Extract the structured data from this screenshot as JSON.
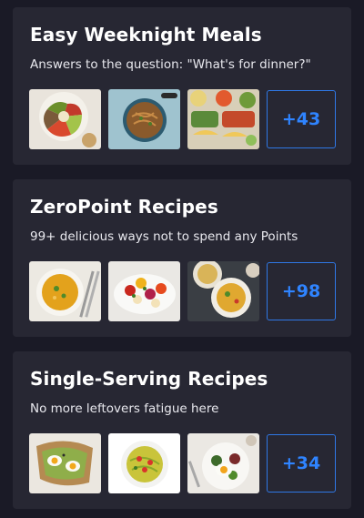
{
  "collections": [
    {
      "title": "Easy Weeknight Meals",
      "subtitle": "Answers to the question: \"What's for dinner?\"",
      "thumbnails": [
        "grain-bowl-photo",
        "noodle-pan-photo",
        "taco-platter-photo"
      ],
      "more_label": "+43"
    },
    {
      "title": "ZeroPoint Recipes",
      "subtitle": "99+ delicious ways not to spend any Points",
      "thumbnails": [
        "curry-soup-photo",
        "stuffed-peppers-photo",
        "soup-bowls-photo"
      ],
      "more_label": "+98"
    },
    {
      "title": "Single-Serving Recipes",
      "subtitle": "No more leftovers fatigue here",
      "thumbnails": [
        "egg-toast-photo",
        "veggie-noodles-photo",
        "egg-salad-photo"
      ],
      "more_label": "+34"
    }
  ],
  "colors": {
    "page_background": "#1a1a26",
    "card_background": "#272733",
    "accent": "#2f84ff"
  }
}
